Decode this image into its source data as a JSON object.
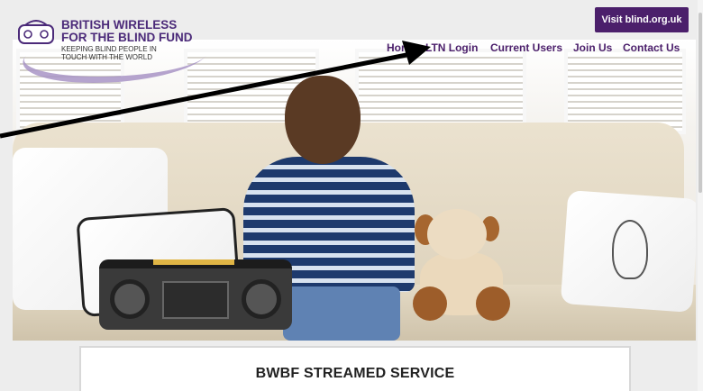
{
  "header": {
    "logo": {
      "line1": "BRITISH WIRELESS",
      "line2": "FOR THE BLIND FUND",
      "tagline1": "KEEPING BLIND PEOPLE IN",
      "tagline2": "TOUCH WITH THE WORLD",
      "icon": "radio-icon"
    },
    "visit_button": "Visit blind.org.uk",
    "nav": [
      "Home",
      "LTN Login",
      "Current Users",
      "Join Us",
      "Contact Us"
    ]
  },
  "hero": {
    "icon": "hero-photo"
  },
  "main": {
    "service_title": "BWBF STREAMED SERVICE"
  },
  "colors": {
    "brand_purple": "#4b1f6b",
    "logo_purple": "#4b2a79",
    "swoosh": "#a995c6"
  }
}
